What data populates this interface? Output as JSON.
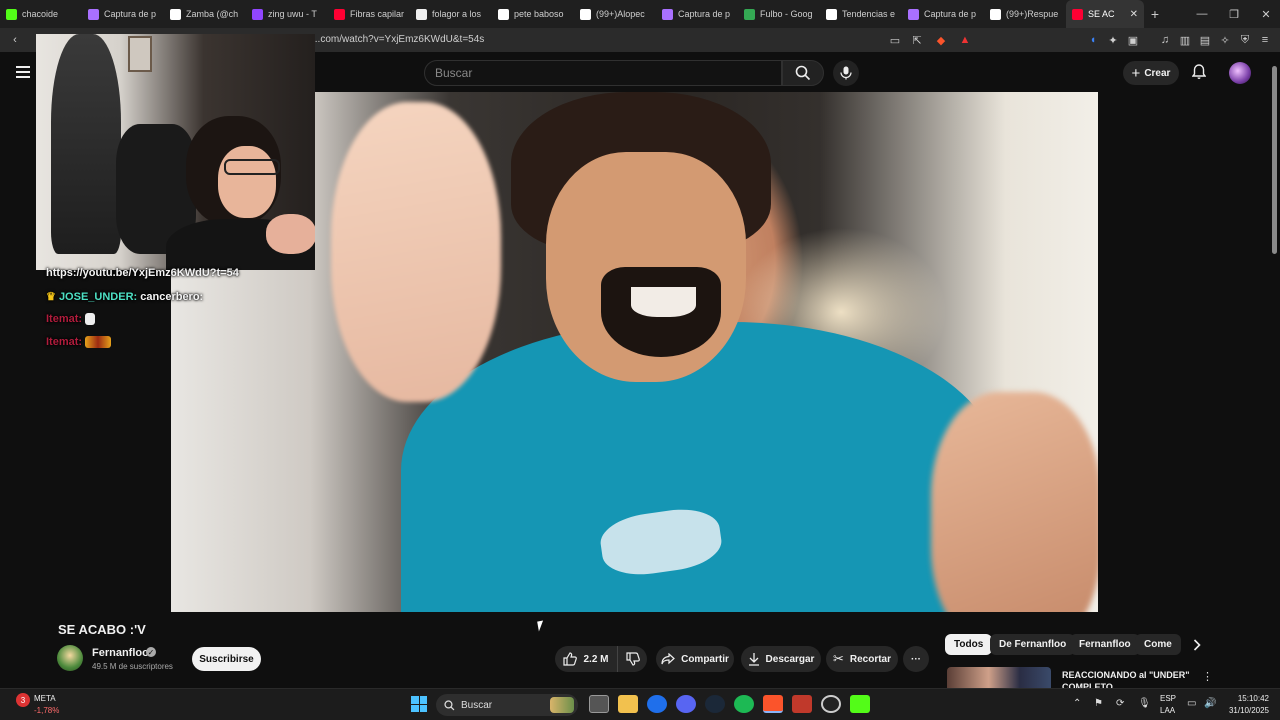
{
  "browser": {
    "tabs": [
      {
        "title": "chacoide",
        "color": "#53fc18"
      },
      {
        "title": "Captura de p",
        "color": "#a970ff"
      },
      {
        "title": "Zamba (@ch",
        "color": "#ffffff"
      },
      {
        "title": "zing uwu - T",
        "color": "#9146ff"
      },
      {
        "title": "Fibras capilar",
        "color": "#ff0033"
      },
      {
        "title": "folagor a los",
        "color": "#eeeeee"
      },
      {
        "title": "pete baboso",
        "color": "#ffffff"
      },
      {
        "title": "(99+)Alopec",
        "color": "#ffffff"
      },
      {
        "title": "Captura de p",
        "color": "#a970ff"
      },
      {
        "title": "Fulbo - Goog",
        "color": "#34a853"
      },
      {
        "title": "Tendencias e",
        "color": "#ffffff"
      },
      {
        "title": "Captura de p",
        "color": "#a970ff"
      },
      {
        "title": "(99+)Respue",
        "color": "#ffffff"
      },
      {
        "title": "SE AC",
        "color": "#ff0033"
      }
    ],
    "active_tab_close": "✕",
    "new_tab": "+",
    "url": "...com/watch?v=YxjEmz6KWdU&t=54s"
  },
  "youtube": {
    "search_placeholder": "Buscar",
    "create_label": "Crear"
  },
  "stream_chat": [
    {
      "name": "",
      "message": "https://youtu.be/YxjEmz6KWdU?t=54"
    },
    {
      "name": "JOSE_UNDER:",
      "message": "cancerbero:"
    },
    {
      "name": "Itemat:",
      "message": ""
    },
    {
      "name": "Itemat:",
      "message": ""
    }
  ],
  "video": {
    "title": "SE ACABO :'V",
    "channel": "Fernanfloo",
    "subscribers": "49.5 M de suscriptores",
    "subscribe_label": "Suscribirse",
    "likes": "2.2 M",
    "share_label": "Compartir",
    "download_label": "Descargar",
    "clip_label": "Recortar",
    "more_label": "···"
  },
  "sidebar": {
    "chips": [
      "Todos",
      "De Fernanfloo",
      "Fernanfloo",
      "Come"
    ],
    "recommended_title": "REACCIONANDO al \"UNDER\" COMPLETO"
  },
  "taskbar": {
    "stock_badge": "3",
    "stock_name": "META",
    "stock_change": "-1,78%",
    "search_label": "Buscar",
    "lang_line1": "ESP",
    "lang_line2": "LAA",
    "time": "15:10:42",
    "date": "31/10/2025"
  }
}
